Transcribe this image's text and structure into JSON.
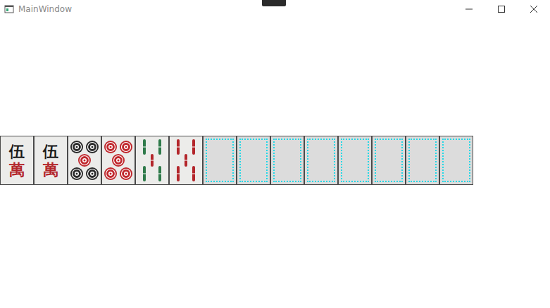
{
  "window": {
    "title": "MainWindow"
  },
  "hand": [
    {
      "kind": "man",
      "chars": [
        "伍",
        "萬"
      ],
      "red": false
    },
    {
      "kind": "man",
      "chars": [
        "伍",
        "萬"
      ],
      "red": false
    },
    {
      "kind": "pin",
      "red": false
    },
    {
      "kind": "pin",
      "red": true
    },
    {
      "kind": "sou",
      "red": false
    },
    {
      "kind": "sou",
      "red": true
    },
    {
      "kind": "empty"
    },
    {
      "kind": "empty"
    },
    {
      "kind": "empty"
    },
    {
      "kind": "empty"
    },
    {
      "kind": "empty"
    },
    {
      "kind": "empty"
    },
    {
      "kind": "empty"
    },
    {
      "kind": "empty"
    }
  ]
}
